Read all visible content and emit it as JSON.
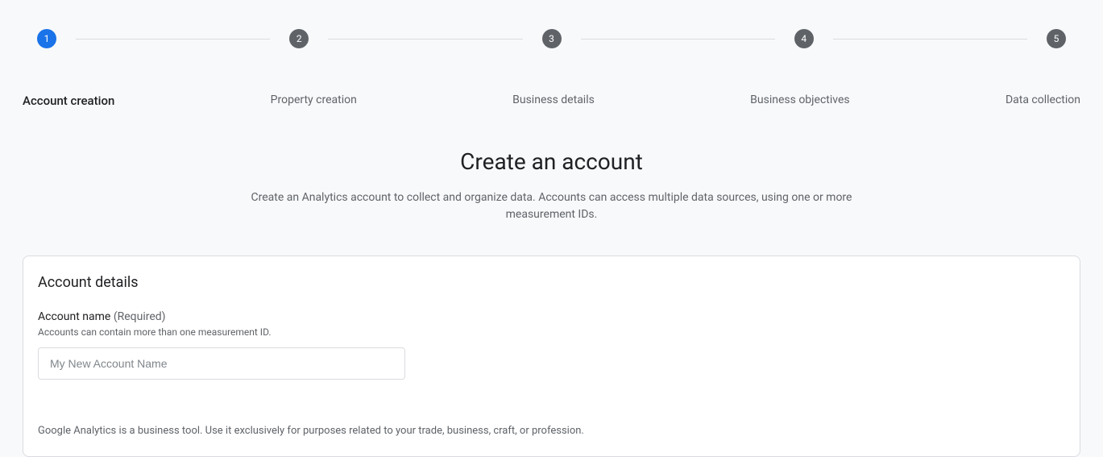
{
  "stepper": {
    "steps": [
      {
        "num": "1",
        "label": "Account creation",
        "active": true
      },
      {
        "num": "2",
        "label": "Property creation",
        "active": false
      },
      {
        "num": "3",
        "label": "Business details",
        "active": false
      },
      {
        "num": "4",
        "label": "Business objectives",
        "active": false
      },
      {
        "num": "5",
        "label": "Data collection",
        "active": false
      }
    ]
  },
  "heading": {
    "title": "Create an account",
    "subtitle": "Create an Analytics account to collect and organize data. Accounts can access multiple data sources, using one or more measurement IDs."
  },
  "card": {
    "title": "Account details",
    "field_label": "Account name",
    "field_required": "(Required)",
    "field_help": "Accounts can contain more than one measurement ID.",
    "input_placeholder": "My New Account Name",
    "input_value": "",
    "disclaimer": "Google Analytics is a business tool. Use it exclusively for purposes related to your trade, business, craft, or profession."
  }
}
